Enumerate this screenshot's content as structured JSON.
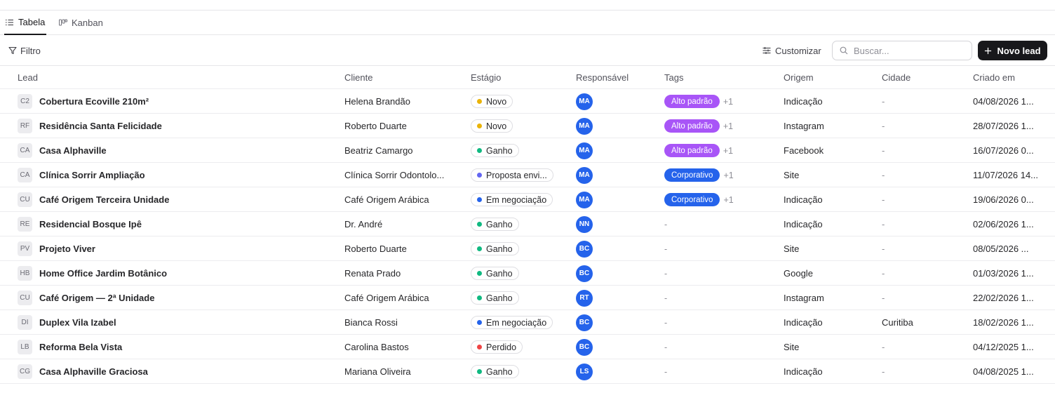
{
  "tabs": [
    {
      "label": "Tabela",
      "icon": "list-icon",
      "active": true
    },
    {
      "label": "Kanban",
      "icon": "kanban-icon",
      "active": false
    }
  ],
  "toolbar": {
    "filter_label": "Filtro",
    "customize_label": "Customizar",
    "search_placeholder": "Buscar...",
    "new_lead_label": "Novo lead"
  },
  "columns": [
    "Lead",
    "Cliente",
    "Estágio",
    "Responsável",
    "Tags",
    "Origem",
    "Cidade",
    "Criado em"
  ],
  "colors": {
    "stage_novo": "#eab308",
    "stage_ganho": "#10b981",
    "stage_proposta": "#6366f1",
    "stage_negociacao": "#2563eb",
    "stage_perdido": "#ef4444",
    "tag_alto_padrao": "#a855f7",
    "tag_corporativo": "#2563eb",
    "avatar": "#2563eb",
    "primary_button": "#18181b"
  },
  "rows": [
    {
      "initials": "C2",
      "lead": "Cobertura Ecoville 210m²",
      "client": "Helena Brandão",
      "stage": "Novo",
      "stage_color": "#eab308",
      "owner": "MA",
      "tag": "Alto padrão",
      "tag_color": "#a855f7",
      "tag_more": "+1",
      "origin": "Indicação",
      "city": "-",
      "created": "04/08/2026 1..."
    },
    {
      "initials": "RF",
      "lead": "Residência Santa Felicidade",
      "client": "Roberto Duarte",
      "stage": "Novo",
      "stage_color": "#eab308",
      "owner": "MA",
      "tag": "Alto padrão",
      "tag_color": "#a855f7",
      "tag_more": "+1",
      "origin": "Instagram",
      "city": "-",
      "created": "28/07/2026 1..."
    },
    {
      "initials": "CA",
      "lead": "Casa Alphaville",
      "client": "Beatriz Camargo",
      "stage": "Ganho",
      "stage_color": "#10b981",
      "owner": "MA",
      "tag": "Alto padrão",
      "tag_color": "#a855f7",
      "tag_more": "+1",
      "origin": "Facebook",
      "city": "-",
      "created": "16/07/2026 0..."
    },
    {
      "initials": "CA",
      "lead": "Clínica Sorrir Ampliação",
      "client": "Clínica Sorrir Odontolo...",
      "stage": "Proposta envi...",
      "stage_color": "#6366f1",
      "owner": "MA",
      "tag": "Corporativo",
      "tag_color": "#2563eb",
      "tag_more": "+1",
      "origin": "Site",
      "city": "-",
      "created": "11/07/2026 14..."
    },
    {
      "initials": "CU",
      "lead": "Café Origem Terceira Unidade",
      "client": "Café Origem Arábica",
      "stage": "Em negociação",
      "stage_color": "#2563eb",
      "owner": "MA",
      "tag": "Corporativo",
      "tag_color": "#2563eb",
      "tag_more": "+1",
      "origin": "Indicação",
      "city": "-",
      "created": "19/06/2026 0..."
    },
    {
      "initials": "RE",
      "lead": "Residencial Bosque Ipê",
      "client": "Dr. André",
      "stage": "Ganho",
      "stage_color": "#10b981",
      "owner": "NN",
      "tag": "",
      "tag_color": "",
      "tag_more": "-",
      "origin": "Indicação",
      "city": "-",
      "created": "02/06/2026 1..."
    },
    {
      "initials": "PV",
      "lead": "Projeto Viver",
      "client": "Roberto Duarte",
      "stage": "Ganho",
      "stage_color": "#10b981",
      "owner": "BC",
      "tag": "",
      "tag_color": "",
      "tag_more": "-",
      "origin": "Site",
      "city": "-",
      "created": "08/05/2026 ..."
    },
    {
      "initials": "HB",
      "lead": "Home Office Jardim Botânico",
      "client": "Renata Prado",
      "stage": "Ganho",
      "stage_color": "#10b981",
      "owner": "BC",
      "tag": "",
      "tag_color": "",
      "tag_more": "-",
      "origin": "Google",
      "city": "-",
      "created": "01/03/2026 1..."
    },
    {
      "initials": "CU",
      "lead": "Café Origem — 2ª Unidade",
      "client": "Café Origem Arábica",
      "stage": "Ganho",
      "stage_color": "#10b981",
      "owner": "RT",
      "tag": "",
      "tag_color": "",
      "tag_more": "-",
      "origin": "Instagram",
      "city": "-",
      "created": "22/02/2026 1..."
    },
    {
      "initials": "DI",
      "lead": "Duplex Vila Izabel",
      "client": "Bianca Rossi",
      "stage": "Em negociação",
      "stage_color": "#2563eb",
      "owner": "BC",
      "tag": "",
      "tag_color": "",
      "tag_more": "-",
      "origin": "Indicação",
      "city": "Curitiba",
      "created": "18/02/2026 1..."
    },
    {
      "initials": "LB",
      "lead": "Reforma Bela Vista",
      "client": "Carolina Bastos",
      "stage": "Perdido",
      "stage_color": "#ef4444",
      "owner": "BC",
      "tag": "",
      "tag_color": "",
      "tag_more": "-",
      "origin": "Site",
      "city": "-",
      "created": "04/12/2025 1..."
    },
    {
      "initials": "CG",
      "lead": "Casa Alphaville Graciosa",
      "client": "Mariana Oliveira",
      "stage": "Ganho",
      "stage_color": "#10b981",
      "owner": "LS",
      "tag": "",
      "tag_color": "",
      "tag_more": "-",
      "origin": "Indicação",
      "city": "-",
      "created": "04/08/2025 1..."
    }
  ]
}
